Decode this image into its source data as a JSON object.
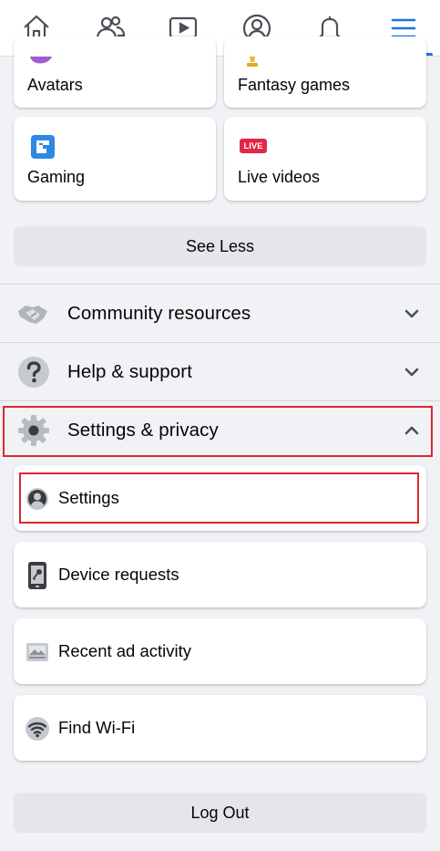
{
  "nav": {
    "tabs": [
      {
        "name": "home",
        "icon": "home-icon"
      },
      {
        "name": "friends",
        "icon": "friends-icon"
      },
      {
        "name": "watch",
        "icon": "video-icon"
      },
      {
        "name": "profile",
        "icon": "profile-icon"
      },
      {
        "name": "notifications",
        "icon": "bell-icon"
      },
      {
        "name": "menu",
        "icon": "hamburger-menu-icon",
        "active": true
      }
    ]
  },
  "shortcuts": {
    "avatars": "Avatars",
    "fantasy_games": "Fantasy games",
    "gaming": "Gaming",
    "live_videos": "Live videos",
    "live_badge": "LIVE"
  },
  "see_less": "See Less",
  "sections": {
    "community": "Community resources",
    "help": "Help & support",
    "settings_privacy": "Settings & privacy"
  },
  "settings_items": {
    "settings": "Settings",
    "device_requests": "Device requests",
    "recent_ad_activity": "Recent ad activity",
    "find_wifi": "Find Wi-Fi"
  },
  "log_out": "Log Out",
  "colors": {
    "accent": "#1b74e4",
    "highlight": "#e0252e",
    "background": "#f0f2f5"
  }
}
